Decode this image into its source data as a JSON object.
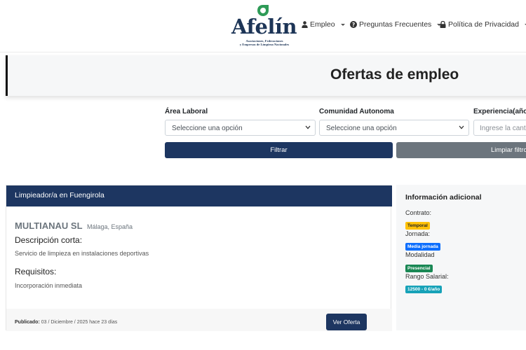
{
  "brand": {
    "name": "Afelín",
    "tagline_lines": [
      "Asociaciones, Federaciones",
      "y Empresas de Limpieza Nacionales"
    ],
    "leaf_color": "#2e9b57",
    "word_color": "#1d3557"
  },
  "nav": {
    "items": [
      {
        "label": "Empleo",
        "icon": "user-icon"
      },
      {
        "label": "Preguntas Frecuentes",
        "icon": "question-circle-icon"
      },
      {
        "label": "Política de Privacidad",
        "icon": "lock-icon"
      }
    ]
  },
  "header": {
    "title": "Ofertas de empleo"
  },
  "filters": {
    "area": {
      "label": "Área Laboral",
      "value": "Seleccione una opción"
    },
    "comunidad": {
      "label": "Comunidad Autonoma",
      "value": "Seleccione una opción"
    },
    "experiencia": {
      "label": "Experiencia(años)",
      "placeholder": "Ingrese la cantidad"
    },
    "filter_button": "Filtrar",
    "clear_button": "Limpiar filtros"
  },
  "job": {
    "title": "Limpieador/a en Fuengirola",
    "company": "MULTIANAU SL",
    "location": "Málaga, España",
    "short_desc_title": "Descripción corta:",
    "short_desc": "Servicio de limpieza en instalaciones deportivas",
    "requirements_title": "Requisitos:",
    "requirements": "Incorporación inmediata",
    "published_label": "Publicado:",
    "published_value": "03 / Diciembre / 2025 hace 23 días",
    "view_button": "Ver Oferta"
  },
  "info": {
    "title": "Información adicional",
    "contract_label": "Contrato:",
    "contract_badge": "Temporal",
    "schedule_label": "Jornada:",
    "schedule_badge": "Media jornada",
    "mode_label": "Modalidad",
    "mode_badge": "Presencial",
    "salary_label": "Rango Salarial:",
    "salary_badge": "12500 - 0 €/año"
  },
  "colors": {
    "primary": "#1d3661",
    "secondary": "#6c757d",
    "badge_temporal": "#ffc107",
    "badge_jornada": "#0d6efd",
    "badge_modalidad": "#198754",
    "badge_salario": "#17a2b8"
  }
}
